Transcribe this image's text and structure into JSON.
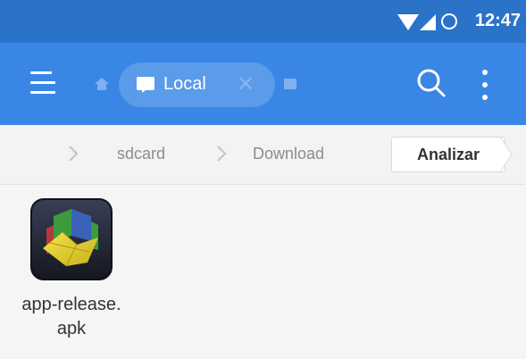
{
  "status_bar": {
    "time": "12:47",
    "icons": [
      "wifi-icon",
      "signal-icon",
      "battery-icon"
    ]
  },
  "app_bar": {
    "menu_icon": "menu-icon",
    "home_icon": "home-icon",
    "tab": {
      "label": "Local",
      "icon": "folder-icon",
      "close_icon": "close-icon"
    },
    "window_icon": "window-icon",
    "search_icon": "search-icon",
    "more_icon": "more-vertical-icon"
  },
  "breadcrumb": {
    "items": [
      "sdcard",
      "Download"
    ],
    "analyze_label": "Analizar"
  },
  "files": [
    {
      "name": "app-release.apk",
      "icon": "apk-app-icon"
    }
  ],
  "colors": {
    "status_bar": "#2b72c9",
    "app_bar": "#3a86e4",
    "chip": "#5a9bea",
    "background": "#f5f5f5"
  }
}
